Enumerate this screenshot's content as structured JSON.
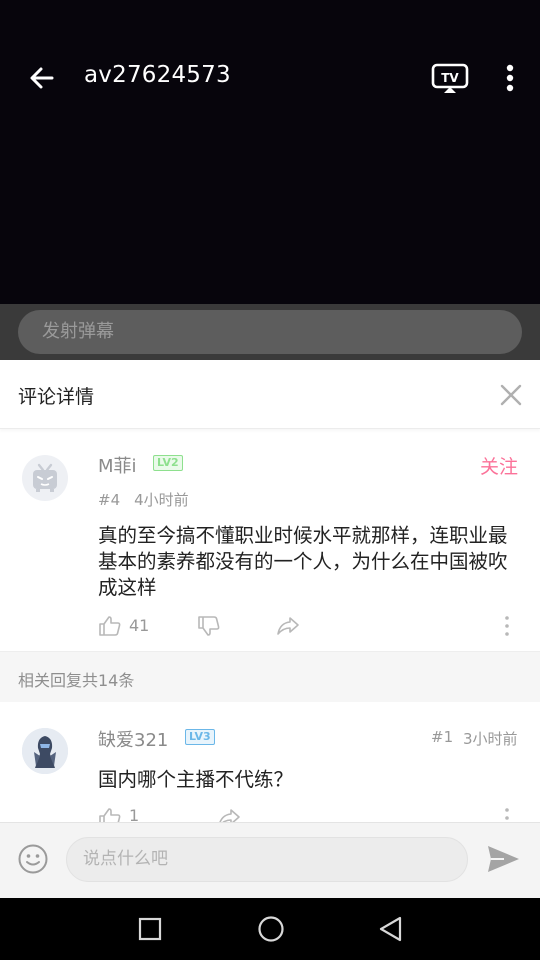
{
  "topbar": {
    "title": "av27624573",
    "back_icon": "arrow-left-icon",
    "tv_icon": "tv-cast-icon",
    "more_icon": "more-vertical-icon"
  },
  "danmaku": {
    "placeholder": "发射弹幕"
  },
  "detail": {
    "title": "评论详情",
    "close_icon": "close-icon"
  },
  "main_comment": {
    "username": "M菲i",
    "level": "LV2",
    "follow_label": "关注",
    "floor": "#4",
    "time": "4小时前",
    "content": "真的至今搞不懂职业时候水平就那样，连职业最基本的素养都没有的一个人，为什么在中国被吹成这样",
    "likes": "41"
  },
  "related": {
    "label": "相关回复共14条"
  },
  "reply": {
    "username": "缺爱321",
    "level": "LV3",
    "floor": "#1",
    "time": "3小时前",
    "content": "国内哪个主播不代练？",
    "likes": "1"
  },
  "bottom": {
    "placeholder": "说点什么吧",
    "emoji_icon": "emoji-icon",
    "send_icon": "send-icon"
  },
  "colors": {
    "accent_pink": "#fb7299",
    "lv2_green": "#8ee08e",
    "lv3_blue": "#6bb7e8"
  }
}
